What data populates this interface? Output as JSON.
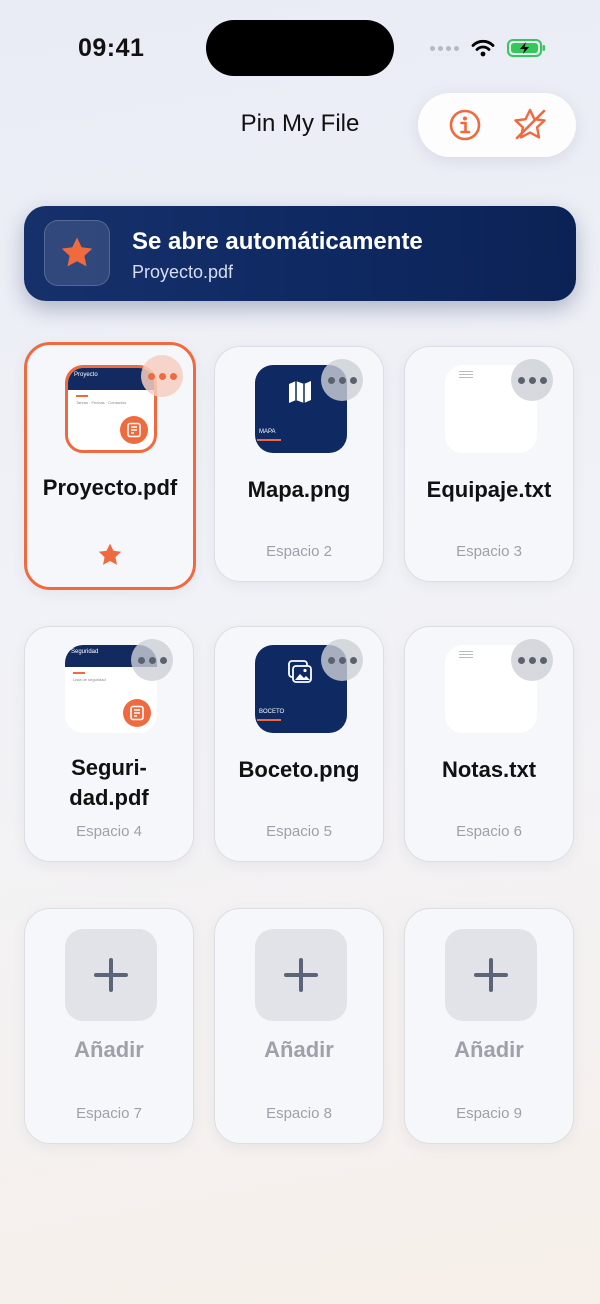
{
  "status_bar": {
    "time": "09:41"
  },
  "header": {
    "title": "Pin My File"
  },
  "banner": {
    "title": "Se abre automáticamente",
    "subtitle": "Proyecto.pdf"
  },
  "colors": {
    "accent": "#f06a3f",
    "navy": "#0f2a63"
  },
  "slots": [
    {
      "name": "Proyecto.pdf",
      "slot": "",
      "kind": "pdf",
      "thumb_title": "Proyecto",
      "thumb_text": "Tareas · Fechas · Contactos",
      "pinned": true
    },
    {
      "name": "Mapa.png",
      "slot": "Espacio 2",
      "kind": "image",
      "thumb_label": "MAPA"
    },
    {
      "name": "Equipaje.txt",
      "slot": "Espacio 3",
      "kind": "text"
    },
    {
      "name": "Seguri-dad.pdf",
      "name_line1": "Seguri-",
      "name_line2": "dad.pdf",
      "slot": "Espacio 4",
      "kind": "pdf",
      "thumb_title": "Seguridad",
      "thumb_text": "Lista de seguridad"
    },
    {
      "name": "Boceto.png",
      "slot": "Espacio 5",
      "kind": "image",
      "thumb_label": "BOCETO"
    },
    {
      "name": "Notas.txt",
      "slot": "Espacio 6",
      "kind": "text"
    },
    {
      "name": "Añadir",
      "slot": "Espacio 7",
      "kind": "empty"
    },
    {
      "name": "Añadir",
      "slot": "Espacio 8",
      "kind": "empty"
    },
    {
      "name": "Añadir",
      "slot": "Espacio 9",
      "kind": "empty"
    }
  ]
}
